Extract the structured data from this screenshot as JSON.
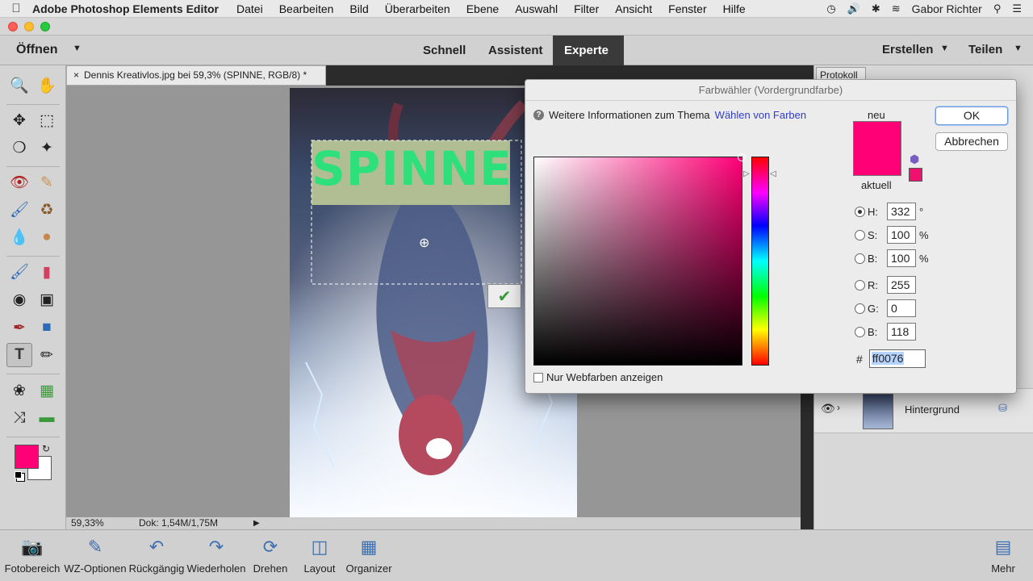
{
  "menubar": {
    "app_name": "Adobe Photoshop Elements Editor",
    "items": [
      "Datei",
      "Bearbeiten",
      "Bild",
      "Überarbeiten",
      "Ebene",
      "Auswahl",
      "Filter",
      "Ansicht",
      "Fenster",
      "Hilfe"
    ],
    "user_name": "Gabor Richter"
  },
  "modebar": {
    "open_label": "Öffnen",
    "modes": [
      "Schnell",
      "Assistent",
      "Experte"
    ],
    "active_mode": "Experte",
    "create_label": "Erstellen",
    "share_label": "Teilen"
  },
  "document": {
    "tab_title": "Dennis Kreativlos.jpg bei 59,3% (SPINNE, RGB/8) *",
    "close_glyph": "×",
    "overlay_text": "SPINNE",
    "zoom": "59,33%",
    "doc_size": "Dok: 1,54M/1,75M"
  },
  "right_panel": {
    "protokoll_tab": "Protokoll",
    "layer_name": "Hintergrund"
  },
  "color_picker": {
    "title": "Farbwähler (Vordergrundfarbe)",
    "info_text": "Weitere Informationen zum Thema",
    "info_link": "Wählen von Farben",
    "new_label": "neu",
    "current_label": "aktuell",
    "ok_label": "OK",
    "cancel_label": "Abbrechen",
    "web_only_label": "Nur Webfarben anzeigen",
    "fields": {
      "H": {
        "label": "H:",
        "value": "332",
        "unit": "°"
      },
      "S": {
        "label": "S:",
        "value": "100",
        "unit": "%"
      },
      "Bv": {
        "label": "B:",
        "value": "100",
        "unit": "%"
      },
      "R": {
        "label": "R:",
        "value": "255",
        "unit": ""
      },
      "G": {
        "label": "G:",
        "value": "0",
        "unit": ""
      },
      "Bc": {
        "label": "B:",
        "value": "118",
        "unit": ""
      }
    },
    "hash": "#",
    "hex": "ff0076",
    "selected_mode": "H"
  },
  "bottombar": {
    "items": [
      "Fotobereich",
      "WZ-Optionen",
      "Rückgängig",
      "Wiederholen",
      "Drehen",
      "Layout",
      "Organizer",
      "Mehr"
    ]
  },
  "colors": {
    "foreground": "#ff0076",
    "background": "#ffffff",
    "title_text_green": "#2ee07a"
  },
  "tools": [
    "zoom-icon",
    "hand-icon",
    "move-icon",
    "marquee-icon",
    "lasso-icon",
    "magic-wand-icon",
    "red-eye-icon",
    "spot-healing-icon",
    "smart-brush-icon",
    "clone-stamp-icon",
    "blur-icon",
    "sponge-icon",
    "brush-icon",
    "eraser-icon",
    "paint-bucket-icon",
    "gradient-icon",
    "eyedropper-icon",
    "shape-icon",
    "type-icon",
    "pencil-icon",
    "cookie-cutter-icon",
    "recompose-icon",
    "content-aware-move-icon",
    "straighten-icon"
  ]
}
